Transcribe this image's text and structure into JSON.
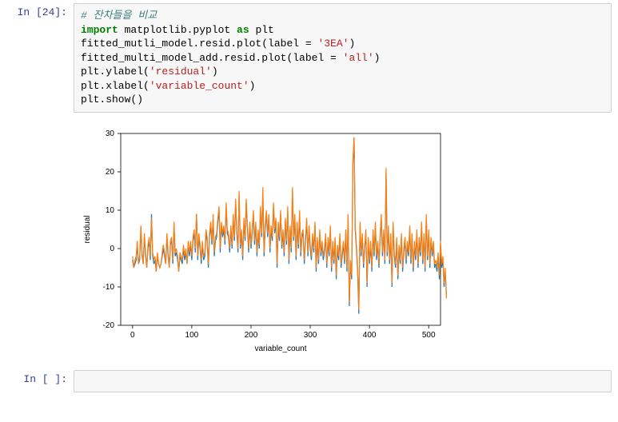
{
  "cells": {
    "input_prompt": "In [24]:",
    "empty_prompt": "In [ ]:"
  },
  "code": {
    "c1": "# 잔차들을 비교",
    "l2_kw1": "import",
    "l2_mid": " matplotlib.pyplot ",
    "l2_kw2": "as",
    "l2_end": " plt",
    "l3_a": "fitted_mutli_model.resid.plot(label = ",
    "l3_s": "'3EA'",
    "l3_b": ")",
    "l4_a": "fitted_multi_model_add.resid.plot(label = ",
    "l4_s": "'all'",
    "l4_b": ")",
    "l5_a": "plt.ylabel(",
    "l5_s": "'residual'",
    "l5_b": ")",
    "l6_a": "plt.xlabel(",
    "l6_s": "'variable_count'",
    "l6_b": ")",
    "l7": "plt.show()"
  },
  "chart_data": {
    "type": "line",
    "title": "",
    "xlabel": "variable_count",
    "ylabel": "residual",
    "xlim": [
      -20,
      520
    ],
    "ylim": [
      -20,
      30
    ],
    "xticks": [
      0,
      100,
      200,
      300,
      400,
      500
    ],
    "yticks": [
      -20,
      -10,
      0,
      10,
      20,
      30
    ],
    "series": [
      {
        "name": "3EA",
        "color": "#1f77b4",
        "x_step": 2,
        "values": [
          -3,
          -5,
          -4,
          -3,
          1,
          -4,
          -3,
          5,
          -2,
          -4,
          3,
          -2,
          -5,
          0,
          2,
          -3,
          9,
          -2,
          -4,
          -3,
          -6,
          -2,
          -4,
          -5,
          -4,
          -2,
          0,
          -2,
          -4,
          3,
          -2,
          -5,
          1,
          2,
          -4,
          6,
          -2,
          -1,
          -3,
          -6,
          -2,
          -3,
          -4,
          0,
          -3,
          -1,
          -4,
          1,
          -2,
          1,
          -3,
          2,
          4,
          -1,
          9,
          -3,
          3,
          0,
          -4,
          1,
          -3,
          -2,
          4,
          2,
          -5,
          3,
          6,
          1,
          8,
          -2,
          2,
          3,
          7,
          10,
          -1,
          6,
          3,
          5,
          1,
          11,
          4,
          3,
          -1,
          5,
          0,
          8,
          2,
          12,
          4,
          -1,
          14,
          0,
          4,
          -3,
          7,
          2,
          12,
          5,
          -1,
          6,
          0,
          4,
          9,
          1,
          6,
          -2,
          4,
          0,
          10,
          3,
          14,
          -2,
          5,
          9,
          3,
          8,
          -1,
          5,
          2,
          11,
          4,
          7,
          -5,
          6,
          2,
          9,
          0,
          4,
          -2,
          7,
          1,
          10,
          -4,
          5,
          -1,
          15,
          2,
          8,
          -3,
          6,
          0,
          9,
          -2,
          3,
          4,
          -4,
          2,
          7,
          -2,
          5,
          0,
          -3,
          3,
          -1,
          6,
          -6,
          2,
          -4,
          4,
          -2,
          1,
          -3,
          -1,
          3,
          -5,
          2,
          -2,
          5,
          -6,
          1,
          -4,
          2,
          -8,
          0,
          -3,
          3,
          -5,
          -2,
          1,
          -4,
          4,
          -6,
          8,
          -15,
          -4,
          -8,
          22,
          29,
          5,
          0,
          -6,
          -17,
          6,
          -2,
          3,
          -5,
          0,
          4,
          -10,
          2,
          -4,
          1,
          -6,
          4,
          -2,
          6,
          -3,
          1,
          -5,
          2,
          8,
          -2,
          4,
          -4,
          20,
          -2,
          5,
          -4,
          3,
          -10,
          6,
          -2,
          -5,
          2,
          -8,
          0,
          -4,
          3,
          -6,
          -1,
          2,
          -4,
          1,
          -2,
          5,
          -4,
          3,
          -6,
          1,
          -3,
          4,
          -5,
          2,
          -2,
          6,
          -4,
          3,
          -6,
          8,
          -3,
          4,
          -5,
          2,
          -2,
          1,
          -5,
          -4,
          -6,
          -2,
          -8,
          1,
          -5,
          -3,
          -10,
          -6,
          -12
        ]
      },
      {
        "name": "all",
        "color": "#ff7f0e",
        "x_step": 2,
        "values": [
          -2,
          -5,
          -3,
          -2,
          2,
          -4,
          -2,
          6,
          -1,
          -4,
          4,
          -1,
          -5,
          1,
          3,
          -2,
          8,
          -1,
          -3,
          -2,
          -6,
          -1,
          -4,
          -5,
          -4,
          -1,
          1,
          -1,
          -4,
          4,
          -1,
          -5,
          2,
          3,
          -3,
          7,
          -1,
          0,
          -2,
          -6,
          -1,
          -2,
          -3,
          1,
          -2,
          0,
          -4,
          2,
          -1,
          2,
          -2,
          3,
          5,
          0,
          9,
          -2,
          4,
          1,
          -3,
          2,
          -2,
          -1,
          5,
          3,
          -4,
          4,
          7,
          2,
          9,
          -1,
          3,
          4,
          8,
          11,
          0,
          7,
          4,
          6,
          2,
          12,
          5,
          4,
          0,
          6,
          1,
          9,
          3,
          13,
          5,
          0,
          15,
          1,
          5,
          -2,
          8,
          3,
          13,
          6,
          0,
          7,
          1,
          5,
          10,
          2,
          7,
          -1,
          5,
          1,
          11,
          4,
          16,
          -1,
          6,
          10,
          4,
          9,
          0,
          6,
          3,
          12,
          5,
          8,
          -4,
          7,
          3,
          10,
          1,
          5,
          -1,
          8,
          2,
          11,
          -3,
          6,
          0,
          16,
          3,
          9,
          -2,
          7,
          1,
          10,
          -1,
          4,
          5,
          -3,
          3,
          8,
          -1,
          6,
          1,
          -2,
          4,
          0,
          7,
          -5,
          3,
          -3,
          5,
          -1,
          2,
          -2,
          0,
          4,
          -4,
          3,
          -1,
          6,
          -5,
          2,
          -3,
          3,
          -7,
          1,
          -2,
          4,
          -4,
          -1,
          2,
          -3,
          5,
          -5,
          9,
          -14,
          -3,
          -7,
          23,
          29,
          6,
          1,
          -5,
          -16,
          7,
          -1,
          4,
          -4,
          1,
          5,
          -9,
          3,
          -3,
          2,
          -5,
          5,
          -1,
          7,
          -2,
          2,
          -4,
          3,
          9,
          -1,
          5,
          -3,
          21,
          -1,
          6,
          -3,
          4,
          -9,
          7,
          -1,
          -4,
          3,
          -7,
          1,
          -3,
          4,
          -5,
          0,
          3,
          -3,
          2,
          -1,
          6,
          -3,
          4,
          -5,
          2,
          -2,
          5,
          -4,
          3,
          -1,
          7,
          -3,
          4,
          -5,
          9,
          -2,
          5,
          -4,
          3,
          -1,
          2,
          -4,
          -3,
          -5,
          -1,
          -7,
          2,
          -4,
          -2,
          -9,
          -5,
          -13
        ]
      }
    ]
  }
}
